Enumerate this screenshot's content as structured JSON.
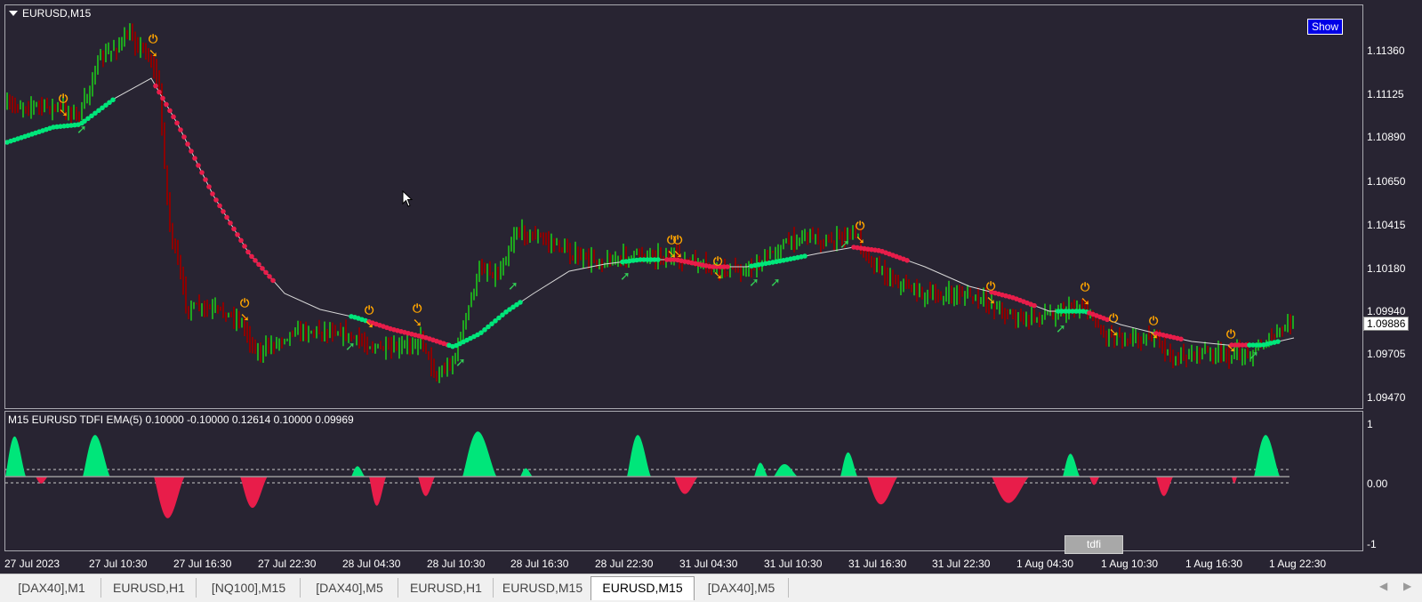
{
  "main_panel": {
    "symbol_label": "EURUSD,M15",
    "show_button_label": "Show",
    "y_axis_labels": [
      "1.11360",
      "1.11125",
      "1.10890",
      "1.10650",
      "1.10415",
      "1.10180",
      "1.09940",
      "1.09705",
      "1.09470"
    ],
    "current_price": "1.09886"
  },
  "indicator_panel": {
    "title": "M15 EURUSD TDFI EMA(5) 0.10000 -0.10000 0.12614 0.10000 0.09969",
    "y_axis_labels": [
      "1",
      "0.00",
      "-1"
    ],
    "indicator_button_label": "tdfi"
  },
  "x_axis_labels": [
    "27 Jul 2023",
    "27 Jul 10:30",
    "27 Jul 16:30",
    "27 Jul 22:30",
    "28 Jul 04:30",
    "28 Jul 10:30",
    "28 Jul 16:30",
    "28 Jul 22:30",
    "31 Jul 04:30",
    "31 Jul 10:30",
    "31 Jul 16:30",
    "31 Jul 22:30",
    "1 Aug 04:30",
    "1 Aug 10:30",
    "1 Aug 16:30",
    "1 Aug 22:30"
  ],
  "tabs": [
    {
      "label": "[DAX40],M1",
      "active": false
    },
    {
      "label": "EURUSD,H1",
      "active": false
    },
    {
      "label": "[NQ100],M15",
      "active": false
    },
    {
      "label": "[DAX40],M5",
      "active": false
    },
    {
      "label": "EURUSD,H1",
      "active": false
    },
    {
      "label": "EURUSD,M15",
      "active": false
    },
    {
      "label": "EURUSD,M15",
      "active": true
    },
    {
      "label": "[DAX40],M5",
      "active": false
    }
  ],
  "colors": {
    "background": "#282432",
    "bull": "#1fa51f",
    "bear": "#8b0000",
    "ma_up": "#00e67a",
    "ma_down": "#e81d4a",
    "signal_sell": "#ffa500",
    "signal_buy": "#33cc55",
    "hist_pos": "#00e67a",
    "hist_neg": "#e81d4a"
  },
  "icons": {
    "nav_left": "triangle-left-icon",
    "nav_right": "triangle-right-icon"
  }
}
